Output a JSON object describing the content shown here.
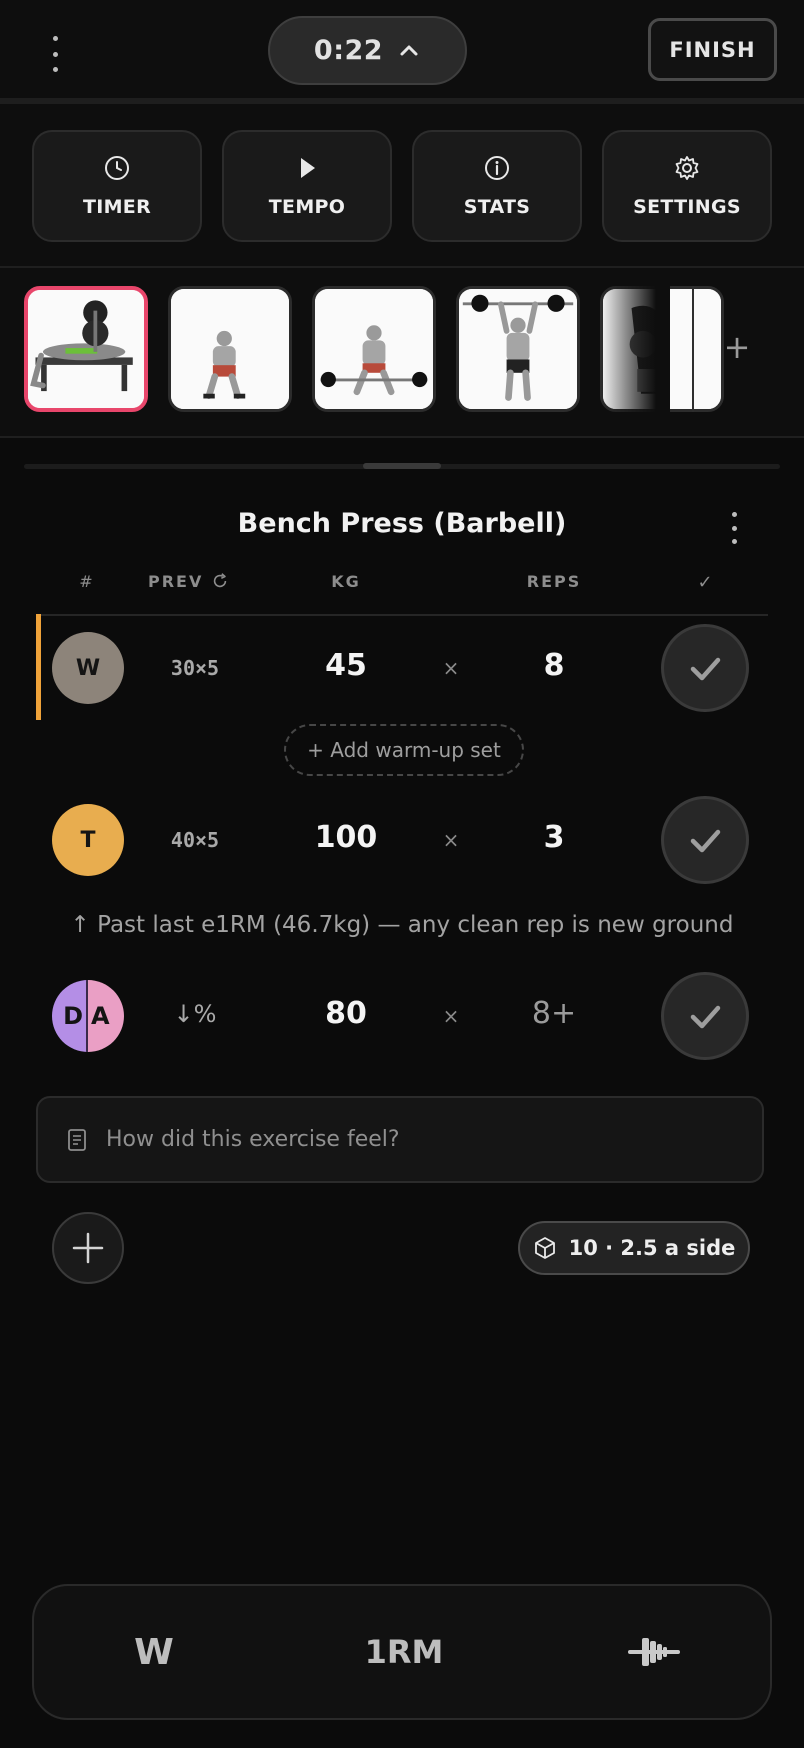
{
  "header": {
    "menu_icon": "kebab-vertical-icon",
    "timer": "0:22",
    "timer_toggle_icon": "chevron-up-icon",
    "finish_label": "FINISH"
  },
  "tools": [
    {
      "label": "TIMER",
      "icon": "clock-icon"
    },
    {
      "label": "TEMPO",
      "icon": "play-icon"
    },
    {
      "label": "STATS",
      "icon": "info-icon"
    },
    {
      "label": "SETTINGS",
      "icon": "gear-icon"
    }
  ],
  "exercise_strip": {
    "active_index": 0,
    "add_label": "+",
    "thumbnails": [
      {
        "icon": "bench-press-figure"
      },
      {
        "icon": "squat-figure"
      },
      {
        "icon": "deadlift-figure"
      },
      {
        "icon": "overhead-press-figure"
      },
      {
        "icon": "leg-exercise-figure"
      }
    ]
  },
  "exercise": {
    "title": "Bench Press (Barbell)",
    "columns": {
      "index": "#",
      "prev": "PREV",
      "kg": "KG",
      "reps": "REPS",
      "done": "✓"
    },
    "sets": [
      {
        "badge": "W",
        "badge_color": "#8d847a",
        "prev": "30×5",
        "kg": "45",
        "times": "×",
        "reps": "8"
      },
      {
        "badge": "T",
        "badge_color": "#e8ad4f",
        "prev": "40×5",
        "kg": "100",
        "times": "×",
        "reps": "3"
      },
      {
        "badge_left": "D",
        "badge_right": "A",
        "badge_colors": [
          "#b48ee6",
          "#ea9fc5"
        ],
        "prev": "↓%",
        "kg": "80",
        "times": "×",
        "reps": "8+"
      }
    ],
    "warmup_button": "+  Add warm-up set",
    "e1rm_hint": "↑  Past last e1RM (46.7kg) — any clean rep is new ground",
    "notes_placeholder": "How did this exercise feel?",
    "plate_calc": "10 · 2.5 a side"
  },
  "dock": {
    "w_label": "W",
    "onerm_label": "1RM",
    "plate_icon": "barbell-icon"
  },
  "colors": {
    "accent_pink": "#e8466b",
    "warmup_accent": "#f0a33a"
  }
}
